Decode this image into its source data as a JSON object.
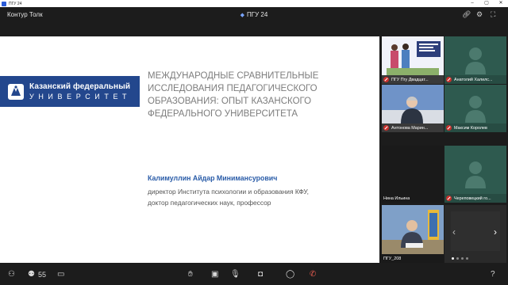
{
  "window": {
    "title": "ПГУ 24"
  },
  "header": {
    "brand": "Контур Толк",
    "room": "ПГУ 24"
  },
  "slide": {
    "logo_line1": "Казанский федеральный",
    "logo_line2": "УНИВЕРСИТЕТ",
    "title": "МЕЖДУНАРОДНЫЕ СРАВНИТЕЛЬНЫЕ ИССЛЕДОВАНИЯ ПЕДАГОГИЧЕСКОГО ОБРАЗОВАНИЯ: ОПЫТ КАЗАНСКОГО ФЕДЕРАЛЬНОГО УНИВЕРСИТЕТА",
    "author": "Калимуллин Айдар Минимансурович",
    "role_line1": "директор Института психологии и образования КФУ,",
    "role_line2": "доктор педагогических наук, профессор"
  },
  "participants": [
    {
      "name": "ПГУ Пгу Двадцат...",
      "muted": true,
      "video": true
    },
    {
      "name": "Анатолий Халилс...",
      "muted": true,
      "video": false
    },
    {
      "name": "Антонова Марин...",
      "muted": true,
      "video": true
    },
    {
      "name": "Максим Королев",
      "muted": true,
      "video": false
    },
    {
      "name": "Нина Ильина",
      "muted": false,
      "video": true
    },
    {
      "name": "Череповецкий го...",
      "muted": true,
      "video": false
    },
    {
      "name": "ПГУ_208",
      "muted": false,
      "video": true
    }
  ],
  "toolbar": {
    "participants_count": "55"
  },
  "colors": {
    "accent": "#3b8de0",
    "slide_blue": "#23478d",
    "mute_red": "#c9302c",
    "tile_green": "#2e5a4f"
  }
}
